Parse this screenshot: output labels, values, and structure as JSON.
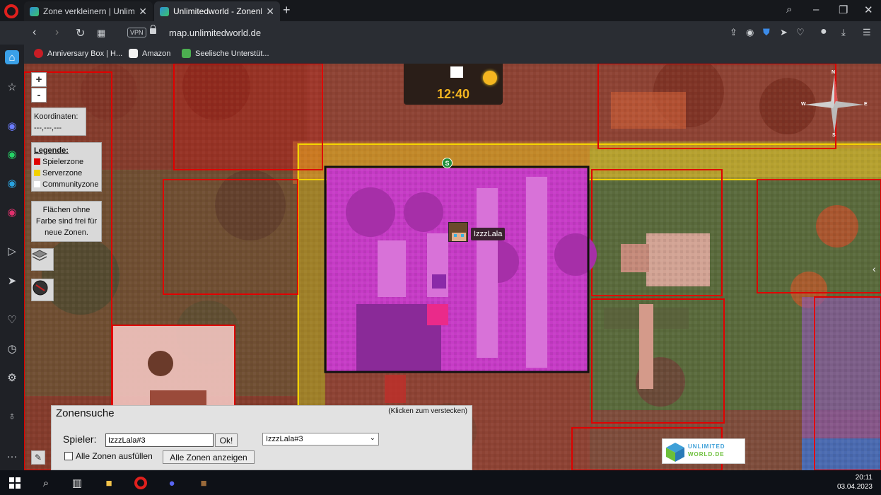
{
  "browser": {
    "tabs": [
      {
        "title": "Zone verkleinern | Unlimite",
        "active": false
      },
      {
        "title": "Unlimitedworld - Zonenkar",
        "active": true
      }
    ],
    "url": "map.unlimitedworld.de",
    "vpn_label": "VPN",
    "bookmarks": [
      "Anniversary Box | H...",
      "Amazon",
      "Seelische Unterstüt..."
    ]
  },
  "map": {
    "zoom_in": "+",
    "zoom_out": "-",
    "coords_label": "Koordinaten:",
    "coords_value": "---,---,---",
    "legend": {
      "title": "Legende:",
      "items": [
        {
          "label": "Spielerzone",
          "color": "#e00000"
        },
        {
          "label": "Serverzone",
          "color": "#f2d100"
        },
        {
          "label": "Communityzone",
          "color": "#ffffff"
        }
      ]
    },
    "hint": "Flächen ohne Farbe sind frei für neue Zonen.",
    "clock": "12:40",
    "player_marker": "IzzzLala",
    "spawn_marker": "S",
    "compass": {
      "n": "N",
      "s": "S",
      "e": "E",
      "w": "W"
    },
    "logo": {
      "line1": "UNLIMITED",
      "line2": "WORLD.DE"
    }
  },
  "zonensuche": {
    "title": "Zonensuche",
    "hide_hint": "(Klicken zum verstecken)",
    "player_label": "Spieler:",
    "player_value": "IzzzLala#3",
    "ok_label": "Ok!",
    "select_value": "IzzzLala#3",
    "fill_label": "Alle Zonen ausfüllen",
    "show_all_label": "Alle Zonen anzeigen"
  },
  "taskbar": {
    "time": "20:11",
    "date": "03.04.2023"
  }
}
